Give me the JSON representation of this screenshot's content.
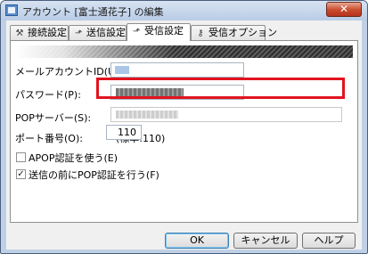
{
  "window": {
    "title": "アカウント [富士通花子] の編集",
    "close_symbol": "✕"
  },
  "tabs": [
    {
      "label": "接続設定",
      "icon": "wrench-icon",
      "glyph": "⚒"
    },
    {
      "label": "送信設定",
      "icon": "send-icon",
      "glyph": "⬏"
    },
    {
      "label": "受信設定",
      "icon": "receive-icon",
      "glyph": "⬏"
    },
    {
      "label": "受信オプション",
      "icon": "key-icon",
      "glyph": "⚷"
    }
  ],
  "form": {
    "mail_account_id_label": "メールアカウントID(U):",
    "password_label": "パスワード(P):",
    "pop_server_label": "POPサーバー(S):",
    "port_label": "ポート番号(O):",
    "port_value": "110",
    "port_default": "(標準:110)",
    "apop_label": "APOP認証を使う(E)",
    "apop_checked": false,
    "pop_before_send_label": "送信の前にPOP認証を行う(F)",
    "pop_before_send_checked": true,
    "check_mark": "✓"
  },
  "buttons": {
    "ok": "OK",
    "cancel": "キャンセル",
    "help": "ヘルプ"
  },
  "colors": {
    "highlight": "#e2141e",
    "accent": "#3c7fb1"
  }
}
